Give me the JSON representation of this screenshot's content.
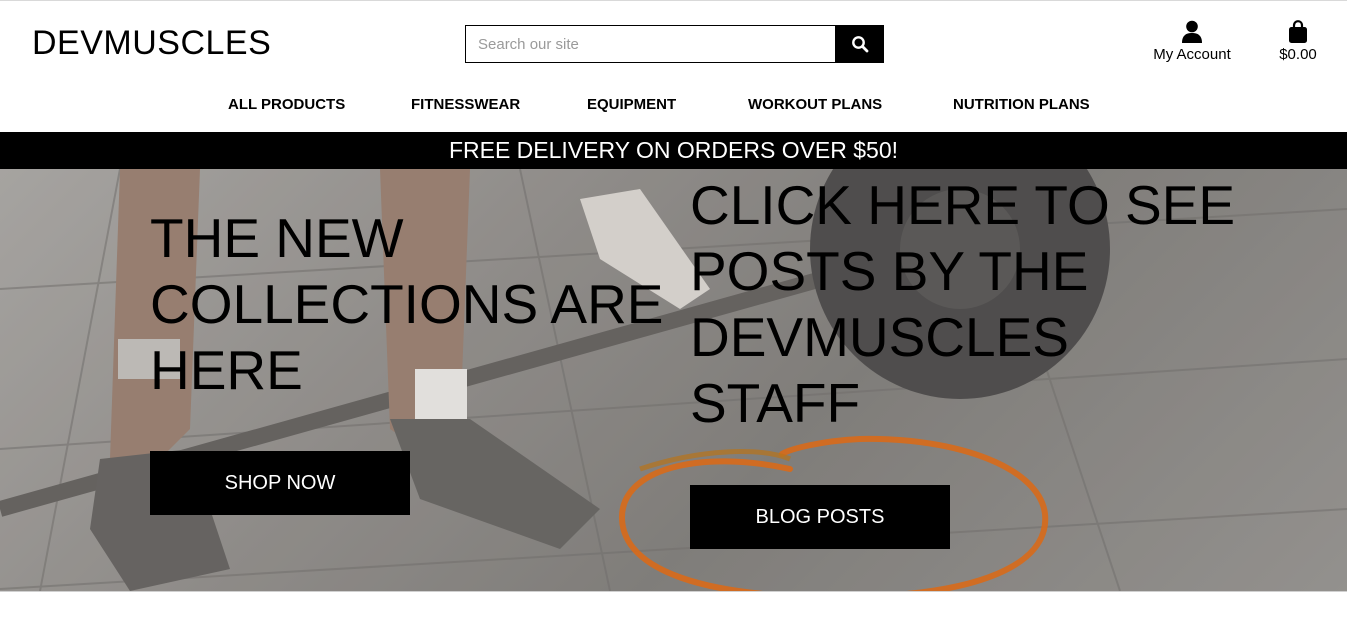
{
  "header": {
    "logo": "DEVMUSCLES",
    "search": {
      "placeholder": "Search our site",
      "value": ""
    },
    "search_button_icon": "search-icon",
    "account": {
      "icon": "user-icon",
      "label": "My Account"
    },
    "cart": {
      "icon": "shopping-bag-icon",
      "total": "$0.00"
    }
  },
  "nav": {
    "items": [
      {
        "label": "ALL PRODUCTS"
      },
      {
        "label": "FITNESSWEAR"
      },
      {
        "label": "EQUIPMENT"
      },
      {
        "label": "WORKOUT PLANS"
      },
      {
        "label": "NUTRITION PLANS"
      }
    ]
  },
  "banner": {
    "text": "FREE DELIVERY ON ORDERS OVER $50!"
  },
  "hero": {
    "left": {
      "heading": "THE NEW COLLECTIONS ARE HERE",
      "button": "SHOP NOW"
    },
    "right": {
      "heading": "CLICK HERE TO SEE POSTS BY THE DEVMUSCLES STAFF",
      "button": "BLOG POSTS"
    }
  },
  "colors": {
    "brand": "#000000",
    "background": "#ffffff",
    "annotation": "#d86a1a"
  }
}
